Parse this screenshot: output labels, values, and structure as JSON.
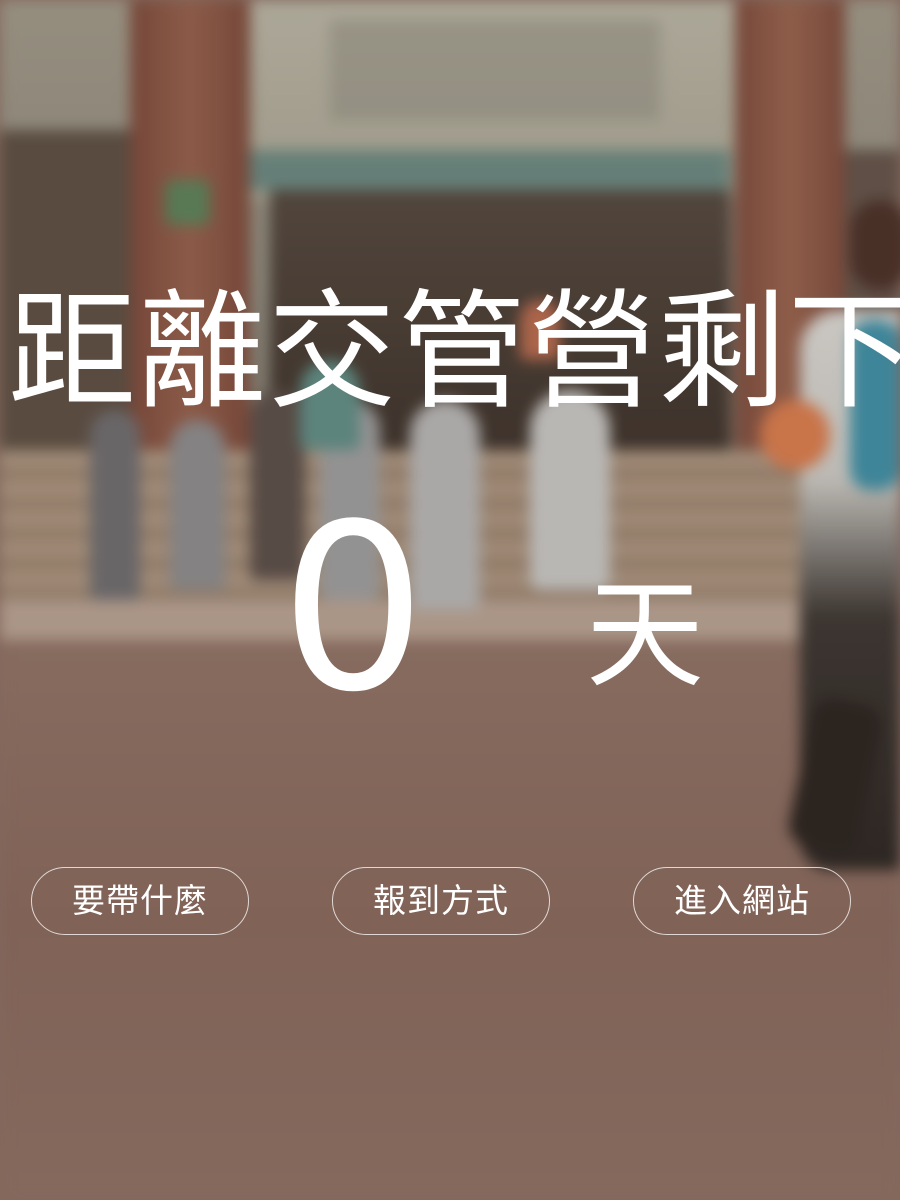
{
  "hero": {
    "headline": "距離交管營剩下",
    "countdown_value": "0",
    "countdown_unit": "天"
  },
  "buttons": {
    "what_to_bring": "要帶什麼",
    "check_in_method": "報到方式",
    "enter_site": "進入網站"
  },
  "colors": {
    "text": "#ffffff",
    "button_border": "#ffffff",
    "background_tone": "#8a6e63"
  }
}
